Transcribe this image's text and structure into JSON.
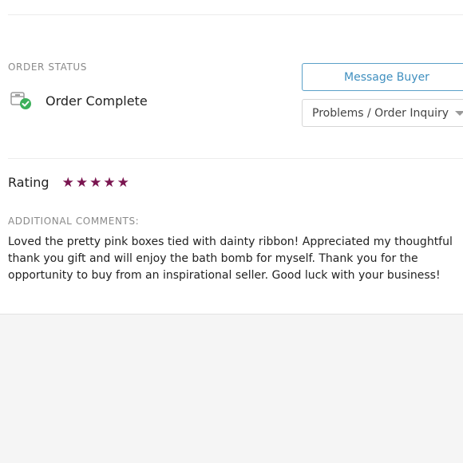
{
  "order_status": {
    "section_label": "ORDER STATUS",
    "status_text": "Order Complete",
    "icon": "box-checkmark-icon"
  },
  "actions": {
    "message_buyer_label": "Message Buyer",
    "problems_select_label": "Problems / Order Inquiry"
  },
  "rating": {
    "label": "Rating",
    "stars": 5,
    "star_color": "#7a1550"
  },
  "comments": {
    "section_label": "ADDITIONAL COMMENTS:",
    "text": "Loved the pretty pink boxes tied with dainty ribbon! Appreciated my thoughtful thank you gift and will enjoy the bath bomb for myself. Thank you for the opportunity to buy from an inspirational seller. Good luck with your business!"
  },
  "colors": {
    "accent": "#3f8fbf",
    "success": "#3cb05a"
  }
}
